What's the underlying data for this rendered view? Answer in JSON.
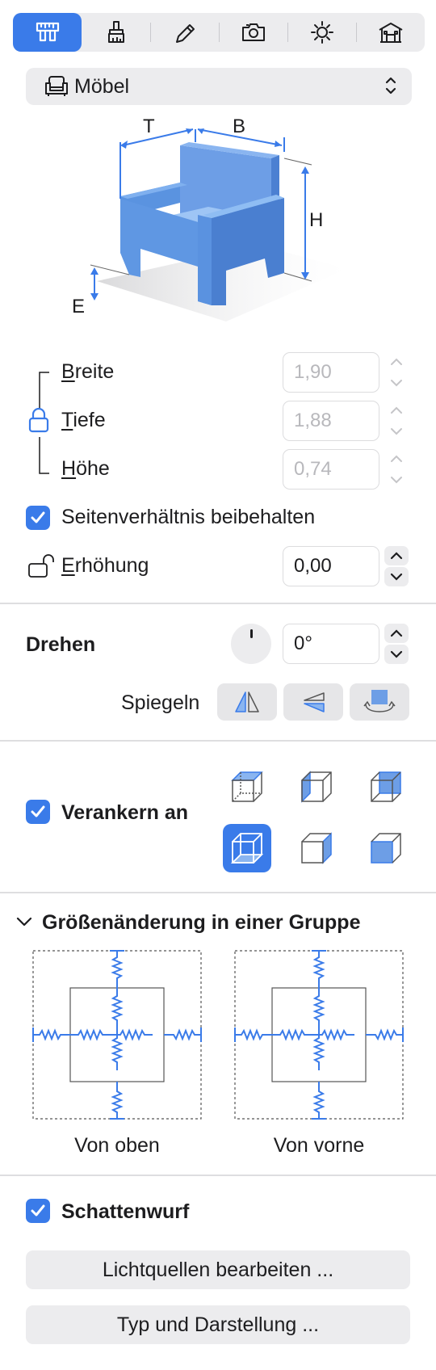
{
  "toolbar": {
    "tabs": [
      {
        "icon": "caliper-icon",
        "active": true
      },
      {
        "icon": "brush-icon",
        "active": false
      },
      {
        "icon": "pencil-icon",
        "active": false
      },
      {
        "icon": "camera-icon",
        "active": false
      },
      {
        "icon": "sun-icon",
        "active": false
      },
      {
        "icon": "house-icon",
        "active": false
      }
    ]
  },
  "category": {
    "label": "Möbel",
    "icon": "armchair-icon"
  },
  "diagram": {
    "labels": {
      "depth": "T",
      "width": "B",
      "height": "H",
      "elevation": "E"
    }
  },
  "dimensions": {
    "width": {
      "label": "Breite",
      "mnemonic": "B",
      "rest": "reite",
      "value": "1,90"
    },
    "depth": {
      "label": "Tiefe",
      "mnemonic": "T",
      "rest": "iefe",
      "value": "1,88"
    },
    "height": {
      "label": "Höhe",
      "mnemonic": "H",
      "rest": "öhe",
      "value": "0,74"
    },
    "keep_ratio": {
      "label": "Seitenverhältnis beibehalten",
      "checked": true
    },
    "elevation": {
      "label": "Erhöhung",
      "mnemonic": "E",
      "rest": "rhöhung",
      "value": "0,00"
    }
  },
  "rotate": {
    "label": "Drehen",
    "value": "0°",
    "mirror_label": "Spiegeln"
  },
  "anchor": {
    "label": "Verankern an",
    "checked": true,
    "selected_index": 3
  },
  "resize_group": {
    "title": "Größenänderung in einer Gruppe",
    "top_caption": "Von oben",
    "front_caption": "Von vorne"
  },
  "shadow": {
    "label": "Schattenwurf",
    "checked": true
  },
  "buttons": {
    "lights": "Lichtquellen bearbeiten ...",
    "type": "Typ und Darstellung ..."
  },
  "colors": {
    "accent": "#3A7BE9",
    "furniture": "#4F8EE0"
  }
}
